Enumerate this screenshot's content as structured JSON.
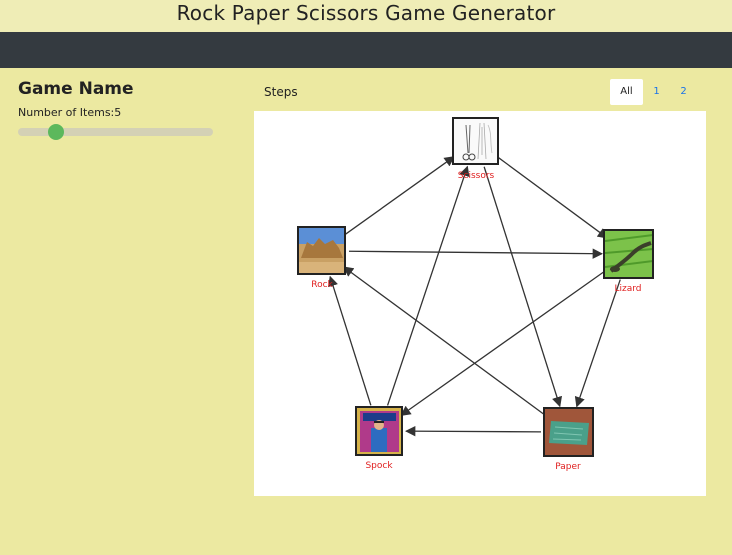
{
  "header": {
    "title": "Rock Paper Scissors Game Generator"
  },
  "sidebar": {
    "game_name": "Game Name",
    "items_label": "Number of Items:",
    "items_value": "5",
    "slider_value": 5
  },
  "main": {
    "steps_label": "Steps",
    "pager": [
      {
        "label": "All",
        "active": true
      },
      {
        "label": "1",
        "active": false
      },
      {
        "label": "2",
        "active": false
      }
    ]
  },
  "graph": {
    "nodes": [
      {
        "id": "scissors",
        "label": "Scissors",
        "icon": "scissors-sketch-image"
      },
      {
        "id": "rock",
        "label": "Rock",
        "icon": "rock-landscape-image"
      },
      {
        "id": "lizard",
        "label": "Lizard",
        "icon": "lizard-photo-image"
      },
      {
        "id": "spock",
        "label": "Spock",
        "icon": "spock-comic-image"
      },
      {
        "id": "paper",
        "label": "Paper",
        "icon": "paper-photo-image"
      }
    ],
    "edges": [
      {
        "from": "rock",
        "to": "scissors"
      },
      {
        "from": "rock",
        "to": "lizard"
      },
      {
        "from": "scissors",
        "to": "lizard"
      },
      {
        "from": "scissors",
        "to": "paper"
      },
      {
        "from": "lizard",
        "to": "paper"
      },
      {
        "from": "lizard",
        "to": "spock"
      },
      {
        "from": "paper",
        "to": "spock"
      },
      {
        "from": "paper",
        "to": "rock"
      },
      {
        "from": "spock",
        "to": "rock"
      },
      {
        "from": "spock",
        "to": "scissors"
      }
    ]
  },
  "colors": {
    "background": "#ece9a1",
    "navbar": "#343a40",
    "slider_thumb": "#5cb85c",
    "node_label": "#e02020",
    "link": "#1a73e8"
  }
}
